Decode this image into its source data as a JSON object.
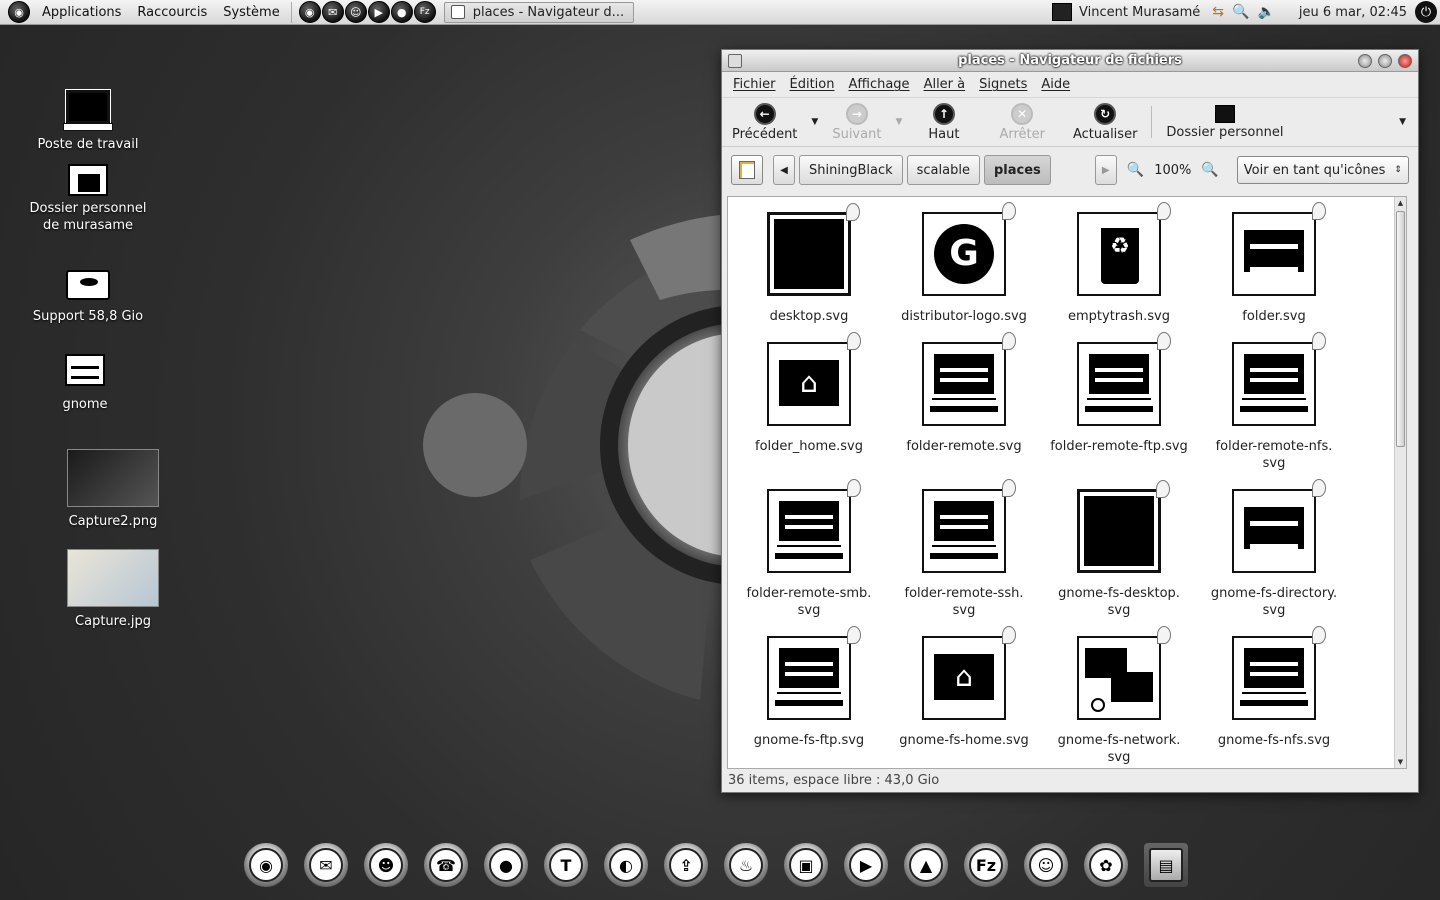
{
  "top_panel": {
    "menus": [
      "Applications",
      "Raccourcis",
      "Système"
    ],
    "launchers": [
      "firefox-icon",
      "mail-icon",
      "chat-icon",
      "play-icon",
      "drop-icon",
      "filezilla-icon"
    ],
    "launcher_glyphs": [
      "◉",
      "✉",
      "☺",
      "▶",
      "●",
      "Fz"
    ],
    "taskbar_item": "places - Navigateur d...",
    "user_name": "Vincent Murasamé",
    "clock": "jeu  6 mar, 02:45"
  },
  "desktop": {
    "icons": [
      {
        "label": "Poste de travail"
      },
      {
        "label": "Dossier personnel de murasame"
      },
      {
        "label": "Support 58,8 Gio"
      },
      {
        "label": "gnome"
      },
      {
        "label": "Capture2.png"
      },
      {
        "label": "Capture.jpg"
      }
    ]
  },
  "window": {
    "title": "places - Navigateur de fichiers",
    "menus": [
      "Fichier",
      "Édition",
      "Affichage",
      "Aller à",
      "Signets",
      "Aide"
    ],
    "toolbar": {
      "back": "Précédent",
      "forward": "Suivant",
      "up": "Haut",
      "stop": "Arrêter",
      "reload": "Actualiser",
      "home": "Dossier personnel"
    },
    "breadcrumbs": [
      "ShiningBlack",
      "scalable",
      "places"
    ],
    "zoom": "100%",
    "view_mode": "Voir en tant qu'icônes",
    "files": [
      {
        "name": "desktop.svg",
        "kind": "black"
      },
      {
        "name": "distributor-logo.svg",
        "kind": "logo"
      },
      {
        "name": "emptytrash.svg",
        "kind": "trash"
      },
      {
        "name": "folder.svg",
        "kind": "folder"
      },
      {
        "name": "folder_home.svg",
        "kind": "home"
      },
      {
        "name": "folder-remote.svg",
        "kind": "remote"
      },
      {
        "name": "folder-remote-ftp.svg",
        "kind": "remote"
      },
      {
        "name": "folder-remote-nfs.\nsvg",
        "kind": "remote"
      },
      {
        "name": "folder-remote-smb.\nsvg",
        "kind": "remote"
      },
      {
        "name": "folder-remote-ssh.\nsvg",
        "kind": "remote"
      },
      {
        "name": "gnome-fs-desktop.\nsvg",
        "kind": "black"
      },
      {
        "name": "gnome-fs-directory.\nsvg",
        "kind": "folder"
      },
      {
        "name": "gnome-fs-ftp.svg",
        "kind": "remote"
      },
      {
        "name": "gnome-fs-home.svg",
        "kind": "home"
      },
      {
        "name": "gnome-fs-network.\nsvg",
        "kind": "net"
      },
      {
        "name": "gnome-fs-nfs.svg",
        "kind": "remote"
      }
    ],
    "status": "36 items, espace libre : 43,0 Gio"
  },
  "dock": {
    "items": [
      "firefox",
      "mail",
      "contacts",
      "voip",
      "drop",
      "download",
      "fish",
      "upload",
      "fire",
      "video",
      "play",
      "vlc",
      "filezilla",
      "smiley",
      "gimp",
      "file-cabinet"
    ],
    "glyphs": [
      "◉",
      "✉",
      "☻",
      "☎",
      "●",
      "T",
      "◐",
      "⇪",
      "♨",
      "▣",
      "▶",
      "▲",
      "Fz",
      "☺",
      "✿",
      "▤"
    ]
  }
}
